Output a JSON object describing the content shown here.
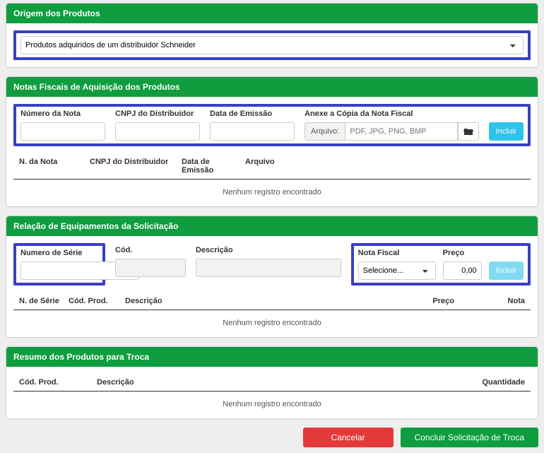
{
  "origin": {
    "title": "Origem dos Produtos",
    "select_value": "Produtos adquiridos de um distribuidor Schneider"
  },
  "invoices": {
    "title": "Notas Fiscais de Aquisição dos Produtos",
    "numero_label": "Número da Nota",
    "cnpj_label": "CNPJ do Distribuidor",
    "data_label": "Data de Emissão",
    "anexo_label": "Anexe a Cópia da Nota Fiscal",
    "arquivo_label": "Arquivo:",
    "file_placeholder": "PDF, JPG, PNG, BMP",
    "incluir": "Incluir",
    "col_nota": "N. da Nota",
    "col_cnpj": "CNPJ do Distribuidor",
    "col_data": "Data de Emissão",
    "col_arquivo": "Arquivo",
    "empty": "Nenhum registro encontrado"
  },
  "equipment": {
    "title": "Relação de Equipamentos da Solicitação",
    "serie_label": "Numero de Série",
    "cod_label": "Cód.",
    "desc_label": "Descrição",
    "nf_label": "Nota Fiscal",
    "nf_value": "Selecione...",
    "preco_label": "Preço",
    "preco_value": "0,00",
    "incluir": "Incluir",
    "col_serie": "N. de Série",
    "col_cod": "Cód. Prod.",
    "col_desc": "Descrição",
    "col_preco": "Preço",
    "col_nota": "Nota",
    "empty": "Nenhum registro encontrado"
  },
  "summary": {
    "title": "Resumo dos Produtos para Troca",
    "col_cod": "Cód. Prod.",
    "col_desc": "Descrição",
    "col_qtd": "Quantidade",
    "empty": "Nenhum registro encontrado"
  },
  "footer": {
    "cancel": "Cancelar",
    "submit": "Concluir Solicitação de Troca"
  }
}
